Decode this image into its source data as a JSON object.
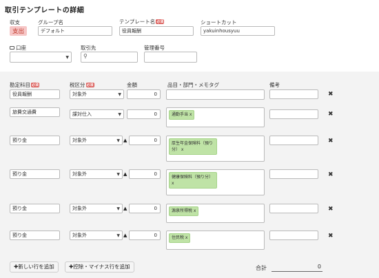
{
  "page_title": "取引テンプレートの詳細",
  "header": {
    "income_expense_label": "収支",
    "income_expense_value": "支出",
    "group_name_label": "グループ名",
    "group_name_value": "デフォルト",
    "template_name_label": "テンプレート名",
    "required_badge": "必須",
    "template_name_value": "役員報酬",
    "shortcut_label": "ショートカット",
    "shortcut_value": "yakuinhousyuu",
    "account_label": "口座",
    "partner_label": "取引先",
    "management_no_label": "管理番号"
  },
  "table": {
    "headers": {
      "account_item": "勘定科目",
      "tax_class": "税区分",
      "amount": "金額",
      "item_dept_memo": "品目・部門・メモタグ",
      "note": "備考"
    },
    "rows": [
      {
        "account": "役員報酬",
        "tax": "対象外",
        "amount": "0",
        "tags": []
      },
      {
        "account": "旅費交通費",
        "tax": "課対仕入",
        "amount": "0",
        "tags": [
          "通勤手当 x"
        ]
      },
      {
        "account": "預り金",
        "tax": "対象外",
        "amount": "0",
        "tags": [
          "厚生年金保険料（預り分） x"
        ]
      },
      {
        "account": "預り金",
        "tax": "対象外",
        "amount": "0",
        "tags": [
          "健康保険料（預り分） x"
        ]
      },
      {
        "account": "預り金",
        "tax": "対象外",
        "amount": "0",
        "tags": [
          "源泉所得税 x"
        ]
      },
      {
        "account": "預り金",
        "tax": "対象外",
        "amount": "0",
        "tags": [
          "住民税 x"
        ]
      }
    ],
    "delete_symbol": "✖"
  },
  "footer": {
    "add_row_button": "✚新しい行を追加",
    "add_deduction_button": "✚控除・マイナス行を追加",
    "total_label": "合計",
    "total_value": "0"
  },
  "colors": {
    "tag_bg": "#bfe3a6",
    "required_bg": "#d9534f",
    "expense_badge_bg": "#f6c6c6",
    "expense_badge_text": "#c0392b"
  }
}
